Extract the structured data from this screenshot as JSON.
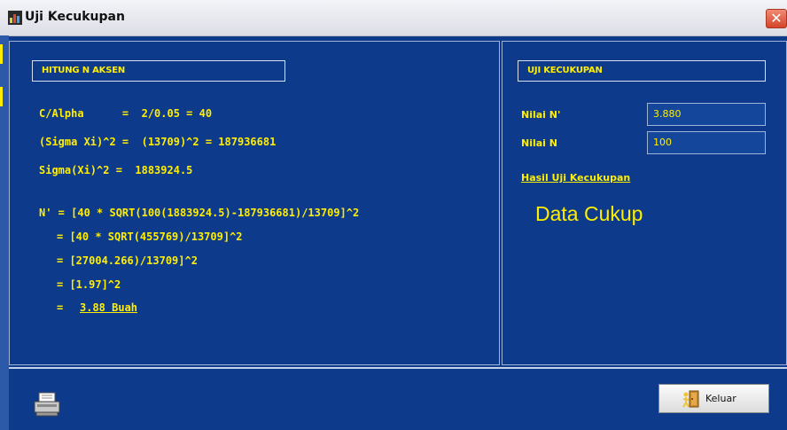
{
  "window": {
    "title": "Uji Kecukupan",
    "close_glyph": "✕"
  },
  "left_section": {
    "header": "HITUNG N AKSEN",
    "lines": [
      "C/Alpha      =  2/0.05 = 40",
      "(Sigma Xi)^2 =  (13709)^2 = 187936681",
      "Sigma(Xi)^2 =  1883924.5",
      "N' = [40 * SQRT(100(1883924.5)-187936681)/13709]^2",
      "= [40 * SQRT(455769)/13709]^2",
      "= [27004.266)/13709]^2",
      "= [1.97]^2",
      "=",
      "3.88 Buah"
    ]
  },
  "right_section": {
    "header": "UJI KECUKUPAN",
    "nilai_n_aksen_label": "Nilai N'",
    "nilai_n_aksen_value": "3.880",
    "nilai_n_label": "Nilai N",
    "nilai_n_value": "100",
    "hasil_link": "Hasil Uji Kecukupan",
    "result": "Data Cukup"
  },
  "footer": {
    "keluar_label": "Keluar"
  },
  "colors": {
    "background": "#0d3a8a",
    "accent_text": "#ffee00",
    "border": "#9fb3d6"
  },
  "icons": {
    "app": "app-icon",
    "print": "printer-icon",
    "exit": "exit-door-icon"
  }
}
